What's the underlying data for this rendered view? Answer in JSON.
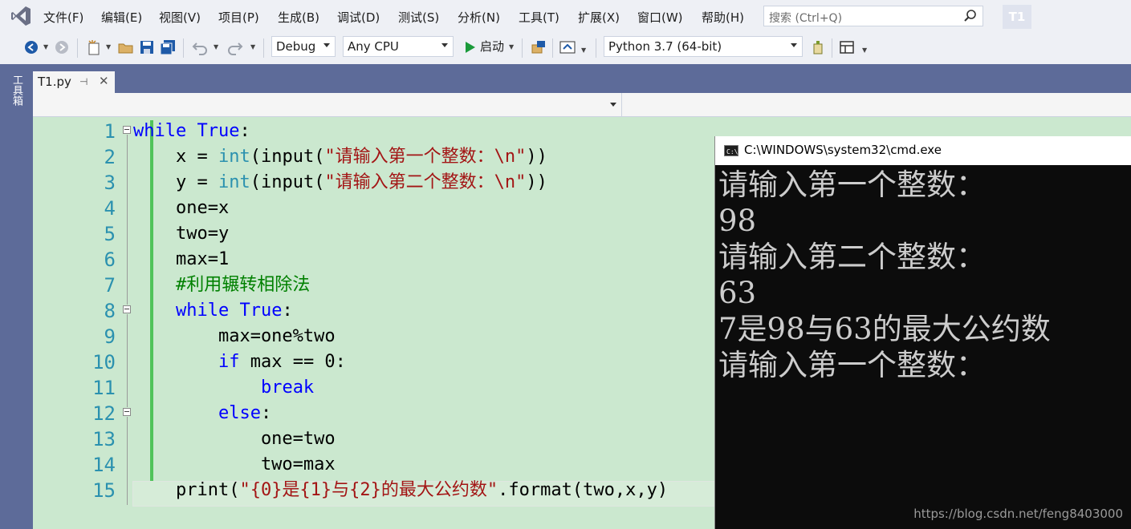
{
  "menu": {
    "items": [
      "文件(F)",
      "编辑(E)",
      "视图(V)",
      "项目(P)",
      "生成(B)",
      "调试(D)",
      "测试(S)",
      "分析(N)",
      "工具(T)",
      "扩展(X)",
      "窗口(W)",
      "帮助(H)"
    ],
    "search_placeholder": "搜索 (Ctrl+Q)",
    "project_badge": "T1"
  },
  "toolbar": {
    "config": "Debug",
    "platform": "Any CPU",
    "start_label": "启动",
    "python_env": "Python 3.7 (64-bit)"
  },
  "sidebar": {
    "toolbox_label": "工具箱"
  },
  "editor": {
    "tab_label": "T1.py",
    "tab_pin_icon": "pin-icon",
    "tab_close_icon": "close-icon",
    "line_numbers": [
      "1",
      "2",
      "3",
      "4",
      "5",
      "6",
      "7",
      "8",
      "9",
      "10",
      "11",
      "12",
      "13",
      "14",
      "15"
    ],
    "code": {
      "l1": {
        "kw": "while",
        "b1": " ",
        "kw2": "True",
        "rest": ":"
      },
      "l2": {
        "pre": "    x = ",
        "bi": "int",
        "mid": "(input(",
        "str": "\"请输入第一个整数：\\n\"",
        "post": "))"
      },
      "l3": {
        "pre": "    y = ",
        "bi": "int",
        "mid": "(input(",
        "str": "\"请输入第二个整数：\\n\"",
        "post": "))"
      },
      "l4": "    one=x",
      "l5": "    two=y",
      "l6": "    max=1",
      "l7": {
        "pre": "    ",
        "cmt": "#利用辗转相除法"
      },
      "l8": {
        "pre": "    ",
        "kw": "while",
        "b1": " ",
        "kw2": "True",
        "rest": ":"
      },
      "l9": "        max=one%two",
      "l10": {
        "pre": "        ",
        "kw": "if",
        "rest": " max == 0:"
      },
      "l11": {
        "pre": "            ",
        "kw": "break"
      },
      "l12": {
        "pre": "        ",
        "kw": "else",
        "rest": ":"
      },
      "l13": "            one=two",
      "l14": "            two=max",
      "l15": {
        "pre": "    print(",
        "str": "\"{0}是{1}与{2}的最大公约数\"",
        "post": ".format(two,x,y)"
      }
    }
  },
  "console": {
    "title": "C:\\WINDOWS\\system32\\cmd.exe",
    "lines": [
      "请输入第一个整数：",
      "98",
      "请输入第二个整数：",
      "63",
      "7是98与63的最大公约数",
      "请输入第一个整数："
    ],
    "watermark": "https://blog.csdn.net/feng8403000"
  }
}
